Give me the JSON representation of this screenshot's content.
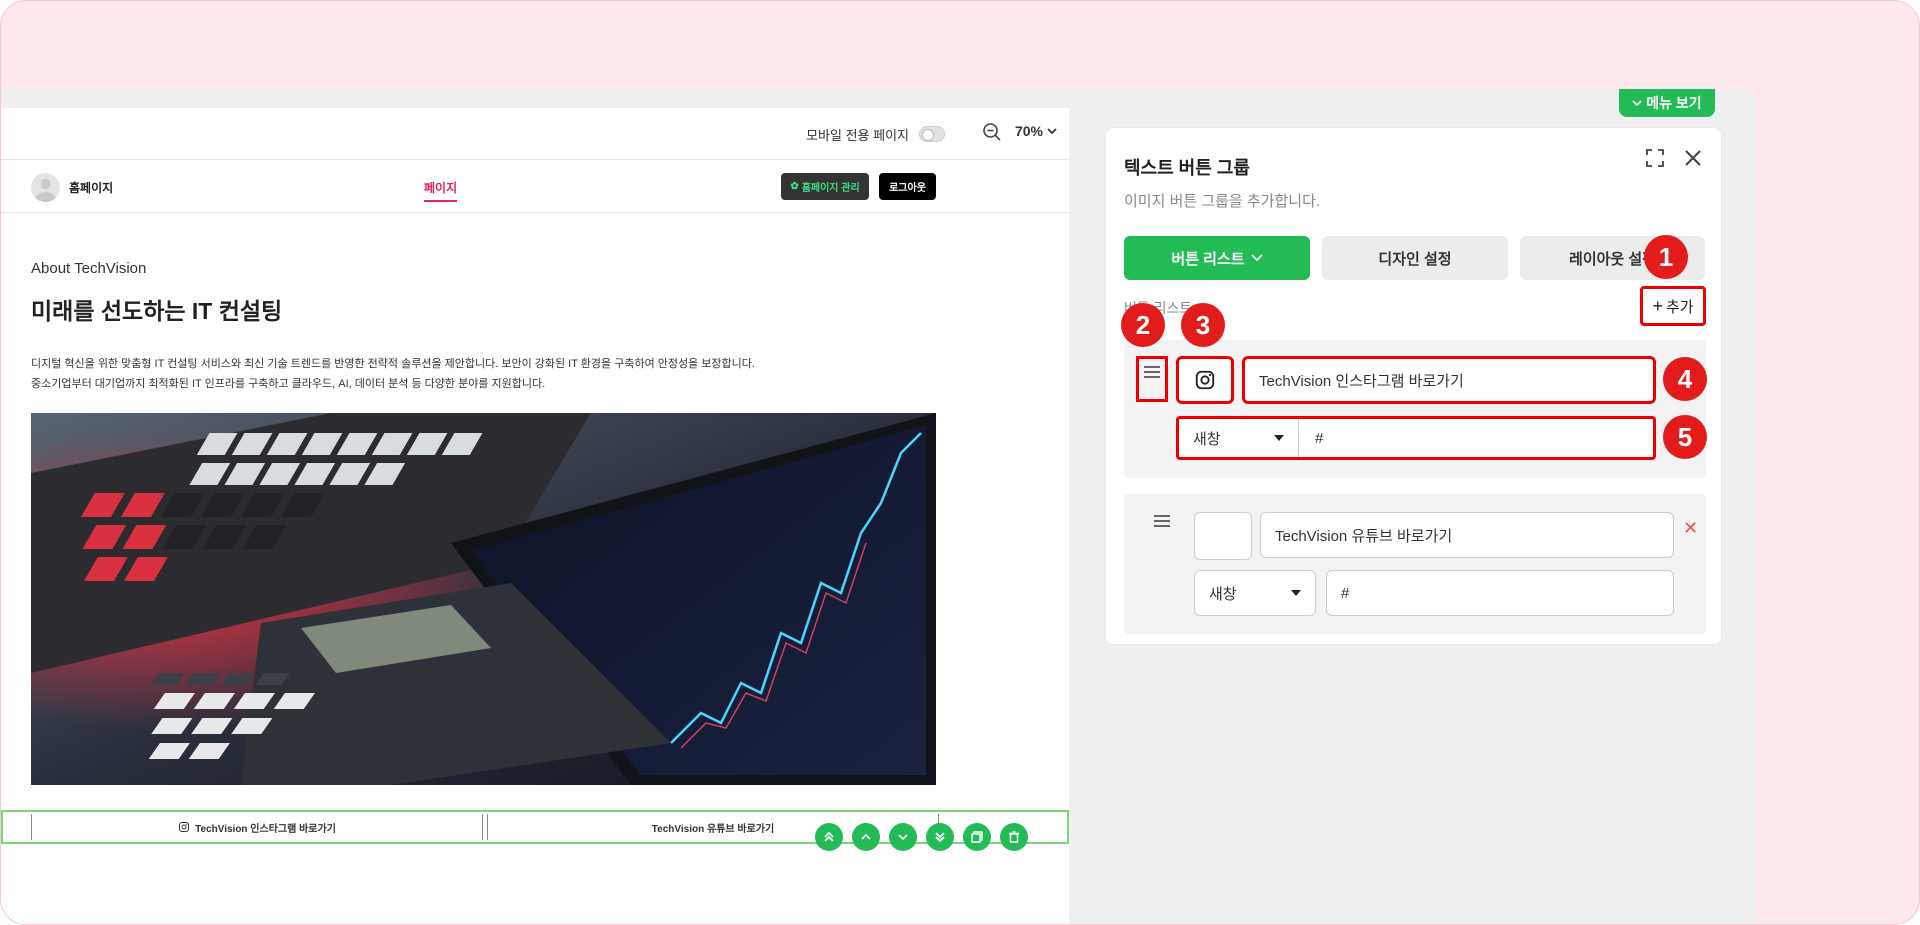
{
  "preview": {
    "mobile_only_label": "모바일 전용 페이지",
    "zoom": "70%",
    "site_name": "홈페이지",
    "nav_page": "페이지",
    "manage_button": "홈페이지 관리",
    "logout_button": "로그아웃",
    "about": "About TechVision",
    "headline": "미래를 선도하는 IT 컨설팅",
    "desc_line1": "디지털 혁신을 위한 맞춤형 IT 컨설팅 서비스와 최신 기술 트렌드를 반영한 전략적 솔루션을 제안합니다. 보안이 강화된 IT 환경을 구축하여 안정성을 보장합니다.",
    "desc_line2": "중소기업부터 대기업까지 최적화된 IT 인프라를 구축하고 클라우드, AI, 데이터 분석 등 다양한 분야를 지원합니다.",
    "buttons": [
      {
        "label": "TechVision 인스타그램 바로가기",
        "icon": "instagram-icon"
      },
      {
        "label": "TechVision 유튜브 바로가기"
      }
    ]
  },
  "menu_view": "메뉴 보기",
  "panel": {
    "title": "텍스트 버튼 그룹",
    "subtitle": "이미지 버튼 그룹을 추가합니다.",
    "tabs": [
      {
        "label": "버튼 리스트",
        "active": true
      },
      {
        "label": "디자인 설정"
      },
      {
        "label": "레이아웃 설정"
      }
    ],
    "list_label": "버튼 리스트",
    "add_label": "추가",
    "items": [
      {
        "icon": "instagram-icon",
        "text": "TechVision 인스타그램 바로가기",
        "target": "새창",
        "link": "#"
      },
      {
        "icon": "",
        "text": "TechVision 유튜브 바로가기",
        "target": "새창",
        "link": "#"
      }
    ]
  },
  "markers": [
    "1",
    "2",
    "3",
    "4",
    "5"
  ],
  "colors": {
    "accent": "#22bb55",
    "highlight": "#e21b1b",
    "nav_active": "#e5265b"
  }
}
